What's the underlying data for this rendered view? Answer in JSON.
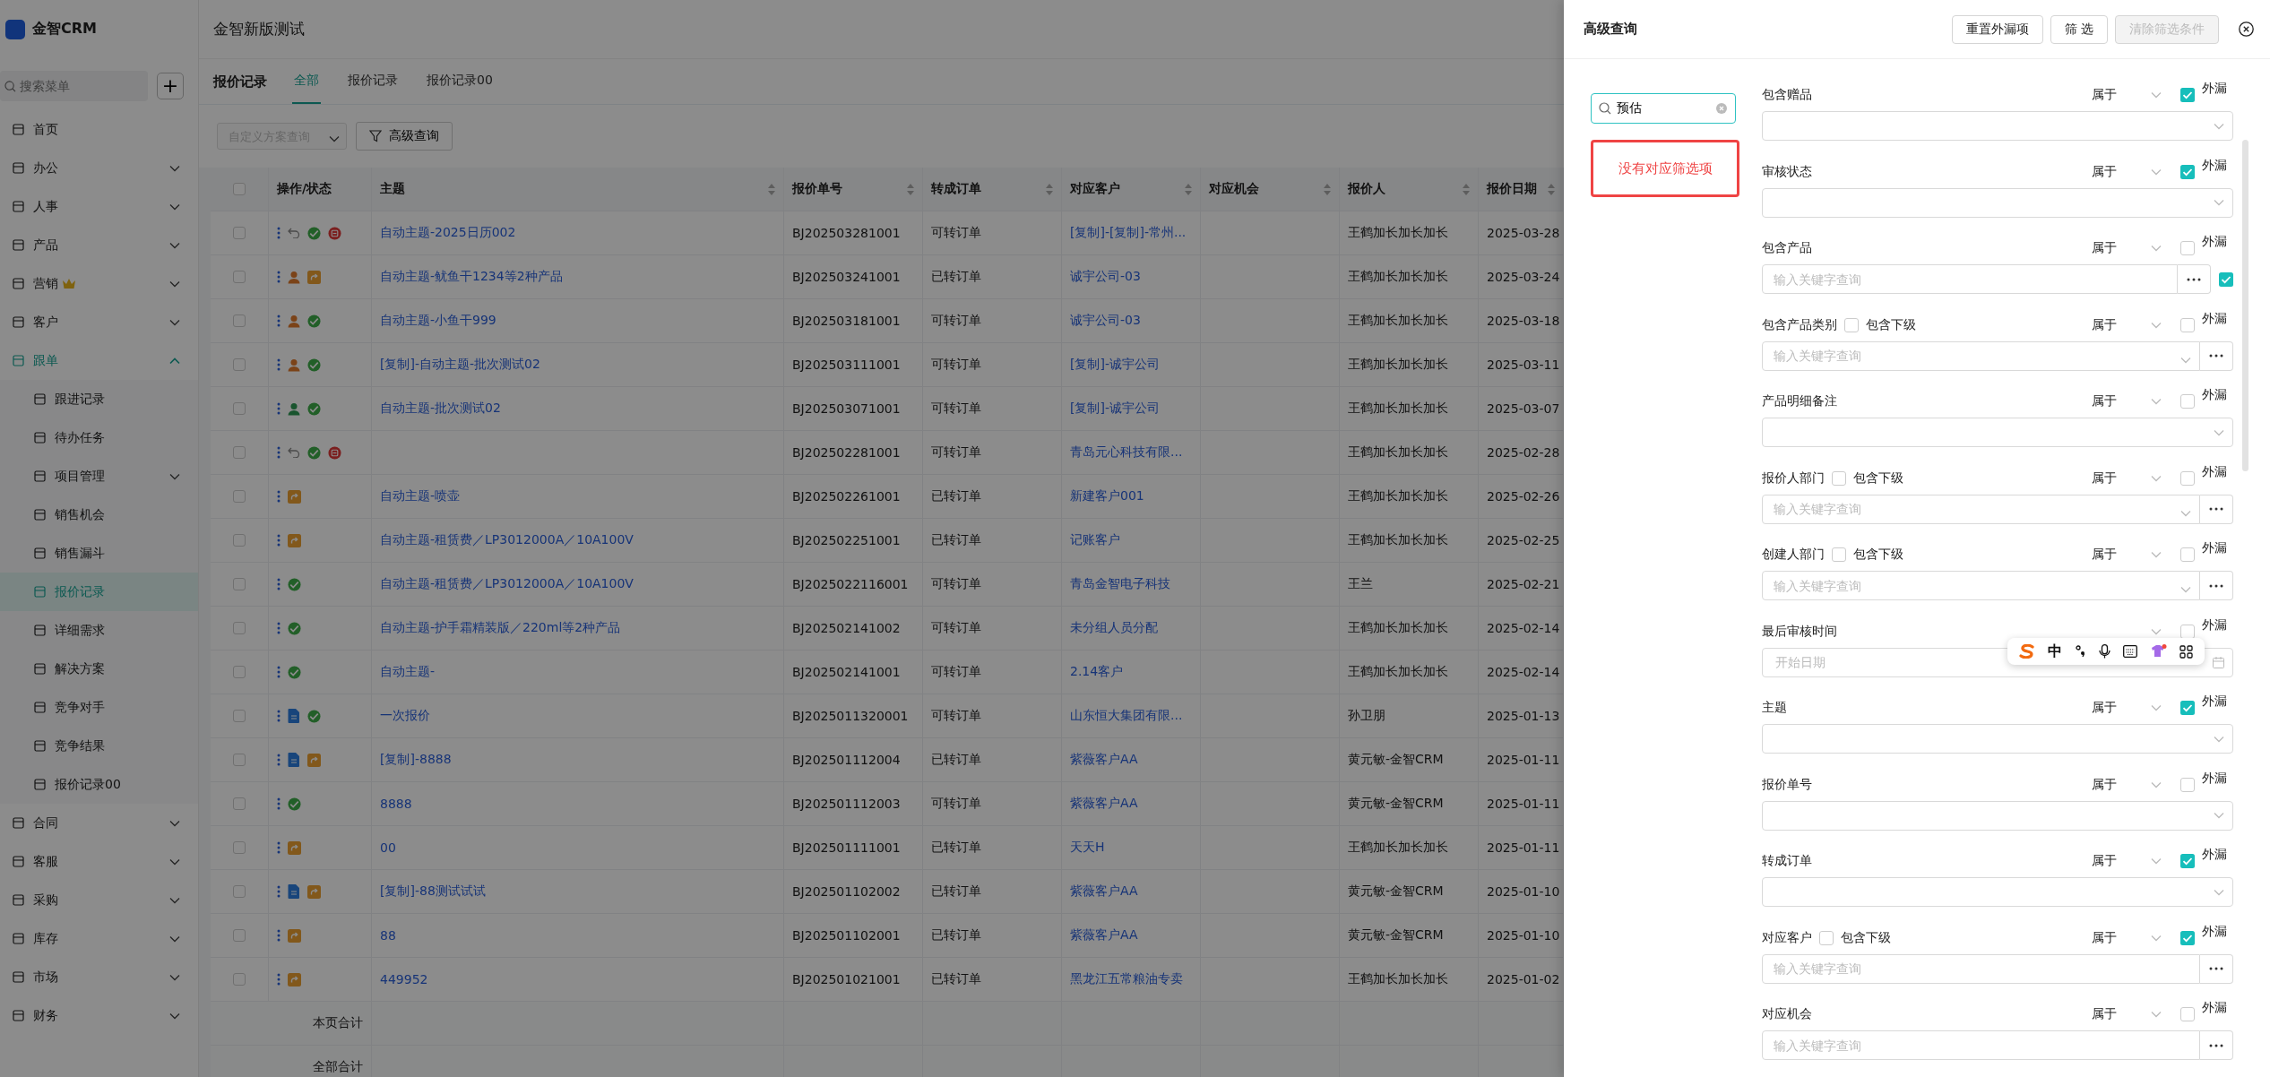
{
  "sidebar": {
    "logo": "金智CRM",
    "search": {
      "placeholder": "搜索菜单"
    },
    "add_button": "+",
    "items": [
      {
        "label": "首页",
        "kind": "link",
        "expanded": false,
        "selected": false,
        "premium": false
      },
      {
        "label": "办公",
        "kind": "group",
        "expanded": false,
        "selected": false,
        "premium": false
      },
      {
        "label": "人事",
        "kind": "group",
        "expanded": false,
        "selected": false,
        "premium": false
      },
      {
        "label": "产品",
        "kind": "group",
        "expanded": false,
        "selected": false,
        "premium": false
      },
      {
        "label": "营销",
        "kind": "group",
        "expanded": false,
        "selected": false,
        "premium": true
      },
      {
        "label": "客户",
        "kind": "group",
        "expanded": false,
        "selected": false,
        "premium": false
      },
      {
        "label": "跟单",
        "kind": "group",
        "expanded": true,
        "selected": false,
        "premium": false,
        "children": [
          {
            "label": "跟进记录",
            "kind": "link",
            "expanded": false,
            "selected": false
          },
          {
            "label": "待办任务",
            "kind": "link",
            "expanded": false,
            "selected": false
          },
          {
            "label": "项目管理",
            "kind": "group",
            "expanded": false,
            "selected": false
          },
          {
            "label": "销售机会",
            "kind": "link",
            "expanded": false,
            "selected": false
          },
          {
            "label": "销售漏斗",
            "kind": "link",
            "expanded": false,
            "selected": false
          },
          {
            "label": "报价记录",
            "kind": "link",
            "expanded": false,
            "selected": true
          },
          {
            "label": "详细需求",
            "kind": "link",
            "expanded": false,
            "selected": false
          },
          {
            "label": "解决方案",
            "kind": "link",
            "expanded": false,
            "selected": false
          },
          {
            "label": "竞争对手",
            "kind": "link",
            "expanded": false,
            "selected": false
          },
          {
            "label": "竞争结果",
            "kind": "link",
            "expanded": false,
            "selected": false
          },
          {
            "label": "报价记录00",
            "kind": "link",
            "expanded": false,
            "selected": false
          }
        ]
      },
      {
        "label": "合同",
        "kind": "group",
        "expanded": false,
        "selected": false,
        "premium": false
      },
      {
        "label": "客服",
        "kind": "group",
        "expanded": false,
        "selected": false,
        "premium": false
      },
      {
        "label": "采购",
        "kind": "group",
        "expanded": false,
        "selected": false,
        "premium": false
      },
      {
        "label": "库存",
        "kind": "group",
        "expanded": false,
        "selected": false,
        "premium": false
      },
      {
        "label": "市场",
        "kind": "group",
        "expanded": false,
        "selected": false,
        "premium": false
      },
      {
        "label": "财务",
        "kind": "group",
        "expanded": false,
        "selected": false,
        "premium": false
      }
    ]
  },
  "page_title": "金智新版测试",
  "tabs_bar": {
    "title": "报价记录",
    "tabs": [
      {
        "label": "全部",
        "selected": true
      },
      {
        "label": "报价记录",
        "selected": false
      },
      {
        "label": "报价记录00",
        "selected": false
      }
    ]
  },
  "toolbar": {
    "scheme_select": {
      "placeholder": "自定义方案查询"
    },
    "advanced_button": "高级查询"
  },
  "table": {
    "select_all_checked": false,
    "columns": [
      {
        "label": "操作/状态",
        "sortable": false
      },
      {
        "label": "主题",
        "sortable": true
      },
      {
        "label": "报价单号",
        "sortable": true
      },
      {
        "label": "转成订单",
        "sortable": true
      },
      {
        "label": "对应客户",
        "sortable": true
      },
      {
        "label": "对应机会",
        "sortable": true
      },
      {
        "label": "报价人",
        "sortable": true
      },
      {
        "label": "报价日期",
        "sortable": true
      }
    ],
    "rows": [
      {
        "checked": false,
        "status": [
          {
            "kind": "revoke"
          },
          {
            "kind": "approved"
          },
          {
            "kind": "rejected"
          }
        ],
        "subject": "自动主题-2025日历002",
        "number": "BJ202503281001",
        "order": "可转订单",
        "customer": "[复制]-[复制]-常州...",
        "person": "王鹤加长加长加长",
        "date": "2025-03-28"
      },
      {
        "checked": false,
        "status": [
          {
            "kind": "assignee"
          },
          {
            "kind": "converted"
          }
        ],
        "subject": "自动主题-鱿鱼干1234等2种产品",
        "number": "BJ202503241001",
        "order": "已转订单",
        "customer": "诚宇公司-03",
        "person": "王鹤加长加长加长",
        "date": "2025-03-24"
      },
      {
        "checked": false,
        "status": [
          {
            "kind": "assignee"
          },
          {
            "kind": "approved"
          }
        ],
        "subject": "自动主题-小鱼干999",
        "number": "BJ202503181001",
        "order": "可转订单",
        "customer": "诚宇公司-03",
        "person": "王鹤加长加长加长",
        "date": "2025-03-18"
      },
      {
        "checked": false,
        "status": [
          {
            "kind": "assignee"
          },
          {
            "kind": "approved"
          }
        ],
        "subject": "[复制]-自动主题-批次测试02",
        "number": "BJ202503111001",
        "order": "可转订单",
        "customer": "[复制]-诚宇公司",
        "person": "王鹤加长加长加长",
        "date": "2025-03-11"
      },
      {
        "checked": false,
        "status": [
          {
            "kind": "approver"
          },
          {
            "kind": "approved"
          }
        ],
        "subject": "自动主题-批次测试02",
        "number": "BJ202503071001",
        "order": "可转订单",
        "customer": "[复制]-诚宇公司",
        "person": "王鹤加长加长加长",
        "date": "2025-03-07"
      },
      {
        "checked": false,
        "status": [
          {
            "kind": "revoke"
          },
          {
            "kind": "approved"
          },
          {
            "kind": "rejected"
          }
        ],
        "number": "BJ202502281001",
        "order": "可转订单",
        "customer": "青岛元心科技有限...",
        "person": "王鹤加长加长加长",
        "date": "2025-02-28"
      },
      {
        "checked": false,
        "status": [
          {
            "kind": "converted"
          }
        ],
        "subject": "自动主题-喷壶",
        "number": "BJ202502261001",
        "order": "已转订单",
        "customer": "新建客户001",
        "person": "王鹤加长加长加长",
        "date": "2025-02-26"
      },
      {
        "checked": false,
        "status": [
          {
            "kind": "converted"
          }
        ],
        "subject": "自动主题-租赁费／LP3012000A／10A100V",
        "number": "BJ202502251001",
        "order": "已转订单",
        "customer": "记账客户",
        "person": "王鹤加长加长加长",
        "date": "2025-02-25"
      },
      {
        "checked": false,
        "status": [
          {
            "kind": "approved"
          }
        ],
        "subject": "自动主题-租赁费／LP3012000A／10A100V",
        "number": "BJ2025022116001",
        "order": "可转订单",
        "customer": "青岛金智电子科技",
        "person": "王兰",
        "date": "2025-02-21"
      },
      {
        "checked": false,
        "status": [
          {
            "kind": "approved"
          }
        ],
        "subject": "自动主题-护手霜精装版／220ml等2种产品",
        "number": "BJ202502141002",
        "order": "可转订单",
        "customer": "未分组人员分配",
        "person": "王鹤加长加长加长",
        "date": "2025-02-14"
      },
      {
        "checked": false,
        "status": [
          {
            "kind": "approved"
          }
        ],
        "subject": "自动主题-",
        "number": "BJ202502141001",
        "order": "可转订单",
        "customer": "2.14客户",
        "person": "王鹤加长加长加长",
        "date": "2025-02-14"
      },
      {
        "checked": false,
        "status": [
          {
            "kind": "attachment"
          },
          {
            "kind": "approved"
          }
        ],
        "subject": "一次报价",
        "number": "BJ2025011320001",
        "order": "可转订单",
        "customer": "山东恒大集团有限...",
        "person": "孙卫朋",
        "date": "2025-01-13"
      },
      {
        "checked": false,
        "status": [
          {
            "kind": "attachment"
          },
          {
            "kind": "converted"
          }
        ],
        "subject": "[复制]-8888",
        "number": "BJ202501112004",
        "order": "已转订单",
        "customer": "紫薇客户AA",
        "person": "黄元敏-金智CRM",
        "date": "2025-01-11"
      },
      {
        "checked": false,
        "status": [
          {
            "kind": "approved"
          }
        ],
        "subject": "8888",
        "number": "BJ202501112003",
        "order": "可转订单",
        "customer": "紫薇客户AA",
        "person": "黄元敏-金智CRM",
        "date": "2025-01-11"
      },
      {
        "checked": false,
        "status": [
          {
            "kind": "converted"
          }
        ],
        "subject": "00",
        "number": "BJ202501111001",
        "order": "已转订单",
        "customer": "天天H",
        "person": "王鹤加长加长加长",
        "date": "2025-01-11"
      },
      {
        "checked": false,
        "status": [
          {
            "kind": "attachment"
          },
          {
            "kind": "converted"
          }
        ],
        "subject": "[复制]-88测试试试",
        "number": "BJ202501102002",
        "order": "已转订单",
        "customer": "紫薇客户AA",
        "person": "黄元敏-金智CRM",
        "date": "2025-01-10"
      },
      {
        "checked": false,
        "status": [
          {
            "kind": "converted"
          }
        ],
        "subject": "88",
        "number": "BJ202501102001",
        "order": "已转订单",
        "customer": "紫薇客户AA",
        "person": "黄元敏-金智CRM",
        "date": "2025-01-10"
      },
      {
        "checked": false,
        "status": [
          {
            "kind": "converted"
          }
        ],
        "subject": "449952",
        "number": "BJ202501021001",
        "order": "已转订单",
        "customer": "黑龙江五常粮油专卖",
        "person": "王鹤加长加长加长",
        "date": "2025-01-02"
      }
    ],
    "footer": [
      "本页合计",
      "全部合计"
    ]
  },
  "drawer": {
    "title": "高级查询",
    "buttons": [
      {
        "label": "重置外漏项",
        "disabled": false
      },
      {
        "label": "筛 选",
        "disabled": false
      },
      {
        "label": "清除筛选条件",
        "disabled": true
      }
    ],
    "search": {
      "value": "预估"
    },
    "empty_message": "没有对应筛选项",
    "filters": [
      {
        "label": "包含赠品",
        "operator": "属于",
        "exclude_label": "外漏",
        "excluded": true,
        "kind": "select"
      },
      {
        "label": "审核状态",
        "operator": "属于",
        "exclude_label": "外漏",
        "excluded": true,
        "kind": "select"
      },
      {
        "label": "包含产品",
        "operator": "属于",
        "exclude_label": "外漏",
        "excluded": false,
        "kind": "keyword-check",
        "placeholder": "输入关键字查询",
        "side_checked": true
      },
      {
        "label": "包含产品类别",
        "include_children": {
          "label": "包含下级",
          "checked": false
        },
        "operator": "属于",
        "exclude_label": "外漏",
        "excluded": false,
        "kind": "keyword-select",
        "placeholder": "输入关键字查询"
      },
      {
        "label": "产品明细备注",
        "operator": "属于",
        "exclude_label": "外漏",
        "excluded": false,
        "kind": "select"
      },
      {
        "label": "报价人部门",
        "include_children": {
          "label": "包含下级",
          "checked": false
        },
        "operator": "属于",
        "exclude_label": "外漏",
        "excluded": false,
        "kind": "keyword-select",
        "placeholder": "输入关键字查询"
      },
      {
        "label": "创建人部门",
        "include_children": {
          "label": "包含下级",
          "checked": false
        },
        "operator": "属于",
        "exclude_label": "外漏",
        "excluded": false,
        "kind": "keyword-select",
        "placeholder": "输入关键字查询"
      },
      {
        "label": "最后审核时间",
        "exclude_label": "外漏",
        "excluded": false,
        "kind": "date-range",
        "placeholder": "开始日期"
      },
      {
        "label": "主题",
        "operator": "属于",
        "exclude_label": "外漏",
        "excluded": true,
        "kind": "select"
      },
      {
        "label": "报价单号",
        "operator": "属于",
        "exclude_label": "外漏",
        "excluded": false,
        "kind": "select"
      },
      {
        "label": "转成订单",
        "operator": "属于",
        "exclude_label": "外漏",
        "excluded": true,
        "kind": "select"
      },
      {
        "label": "对应客户",
        "include_children": {
          "label": "包含下级",
          "checked": false
        },
        "operator": "属于",
        "exclude_label": "外漏",
        "excluded": true,
        "kind": "keyword",
        "placeholder": "输入关键字查询"
      },
      {
        "label": "对应机会",
        "operator": "属于",
        "exclude_label": "外漏",
        "excluded": false,
        "kind": "keyword",
        "placeholder": "输入关键字查询"
      }
    ]
  },
  "ime_toolbar": {
    "mode": "中"
  }
}
